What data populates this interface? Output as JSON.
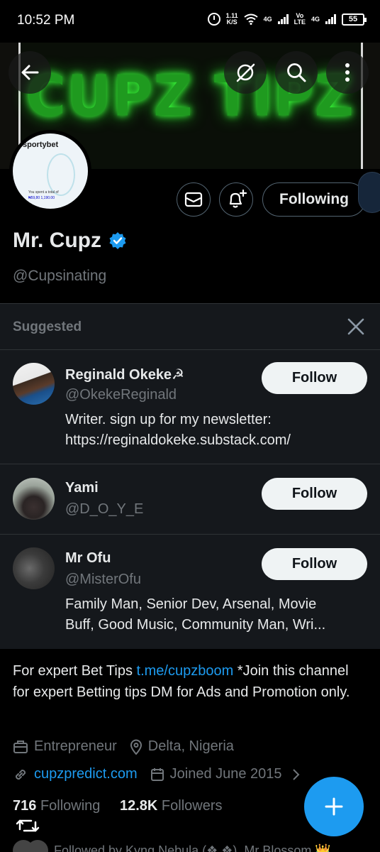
{
  "status_bar": {
    "time": "10:52 PM",
    "speed_value": "1.11",
    "speed_unit": "K/S",
    "network_1": "4G",
    "volte_1": "Vo",
    "volte_2": "LTE",
    "network_2": "4G",
    "battery": "55"
  },
  "banner": {
    "text": "CUPZ TIPZ"
  },
  "avatar": {
    "brand": "sportybet",
    "fine_print": "You spent a total of",
    "fine_amount": "₦59,80 1,190.00"
  },
  "profile": {
    "name": "Mr. Cupz",
    "handle": "@Cupsinating",
    "following_label": "Following"
  },
  "suggested": {
    "title": "Suggested",
    "follow_label": "Follow",
    "items": [
      {
        "name": "Reginald Okeke☭",
        "handle": "@OkekeReginald",
        "bio_line1": "Writer. sign up for my newsletter:",
        "bio_line2": "https://reginaldokeke.substack.com/"
      },
      {
        "name": "Yami",
        "handle": "@D_O_Y_E"
      },
      {
        "name": "Mr Ofu",
        "handle": "@MisterOfu",
        "bio_line1": "Family Man, Senior Dev, Arsenal, Movie",
        "bio_line2": "Buff, Good Music, Community Man, Wri..."
      }
    ]
  },
  "bio": {
    "prefix": "For expert Bet Tips ",
    "link": "t.me/cupzboom",
    "suffix": " *Join this channel for expert Betting tips DM for Ads and Promotion only."
  },
  "meta": {
    "category": "Entrepreneur",
    "location": "Delta, Nigeria",
    "website": "cupzpredict.com",
    "joined": "Joined June 2015"
  },
  "stats": {
    "following_count": "716",
    "following_label": "Following",
    "followers_count": "12.8K",
    "followers_label": "Followers"
  },
  "followed_by": {
    "text": "Followed by Kyng Nebula (❖ ❖), Mr Blossom 👑"
  },
  "colors": {
    "accent": "#1d9bf0",
    "background": "#000000",
    "panel": "#15181c",
    "muted_text": "#71767b",
    "banner_glow": "#39ff3a"
  }
}
